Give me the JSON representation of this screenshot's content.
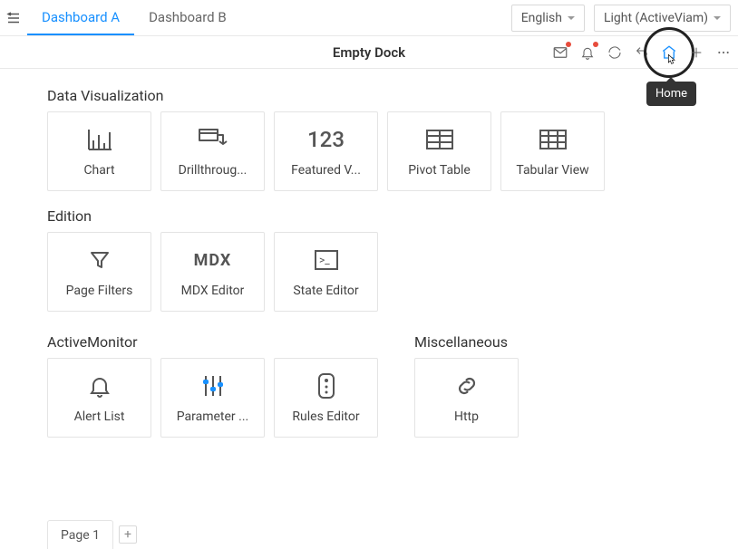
{
  "topbar": {
    "tabs": [
      {
        "label": "Dashboard A",
        "active": true
      },
      {
        "label": "Dashboard B",
        "active": false
      }
    ],
    "language_dropdown": "English",
    "theme_dropdown": "Light (ActiveViam)"
  },
  "titlebar": {
    "title": "Empty Dock",
    "tooltip_home": "Home"
  },
  "sections": {
    "data_visualization": {
      "title": "Data Visualization",
      "cards": [
        {
          "label": "Chart",
          "icon": "chart-icon"
        },
        {
          "label": "Drillthroug...",
          "icon": "drillthrough-icon"
        },
        {
          "label": "Featured V...",
          "icon": "featured-values-icon"
        },
        {
          "label": "Pivot Table",
          "icon": "pivot-table-icon"
        },
        {
          "label": "Tabular View",
          "icon": "tabular-view-icon"
        }
      ]
    },
    "edition": {
      "title": "Edition",
      "cards": [
        {
          "label": "Page Filters",
          "icon": "filter-icon"
        },
        {
          "label": "MDX Editor",
          "icon": "mdx-icon"
        },
        {
          "label": "State Editor",
          "icon": "state-editor-icon"
        }
      ]
    },
    "active_monitor": {
      "title": "ActiveMonitor",
      "cards": [
        {
          "label": "Alert List",
          "icon": "bell-icon"
        },
        {
          "label": "Parameter ...",
          "icon": "parameter-icon"
        },
        {
          "label": "Rules Editor",
          "icon": "rules-icon"
        }
      ]
    },
    "miscellaneous": {
      "title": "Miscellaneous",
      "cards": [
        {
          "label": "Http",
          "icon": "link-icon"
        }
      ]
    }
  },
  "pages": {
    "tabs": [
      {
        "label": "Page 1"
      }
    ]
  }
}
